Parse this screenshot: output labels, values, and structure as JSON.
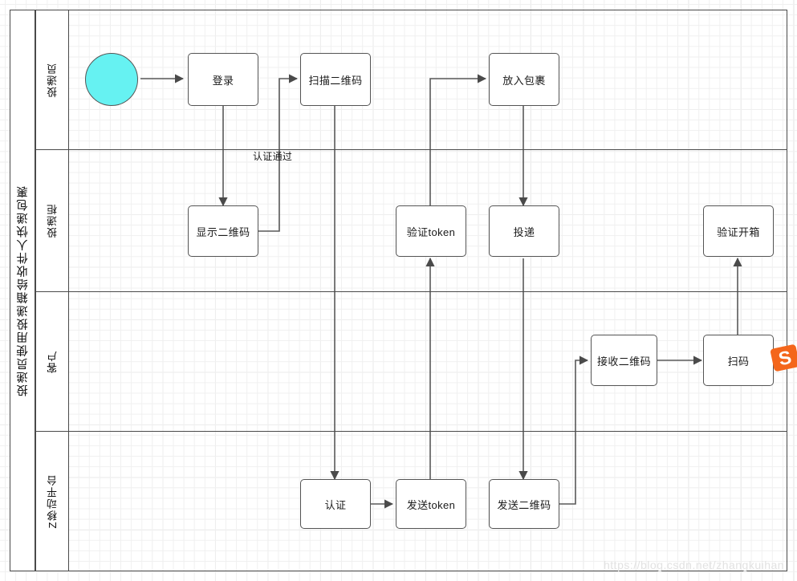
{
  "pool": {
    "title": "投递员使用投递箱给收件人快递包裹"
  },
  "lanes": [
    {
      "id": "courier",
      "label": "投递员"
    },
    {
      "id": "locker",
      "label": "投递柜"
    },
    {
      "id": "customer",
      "label": "客户"
    },
    {
      "id": "platform",
      "label": "Z移动平台"
    }
  ],
  "nodes": [
    {
      "id": "start",
      "label": "",
      "lane": "courier",
      "shape": "circle"
    },
    {
      "id": "login",
      "label": "登录",
      "lane": "courier",
      "shape": "rect"
    },
    {
      "id": "scan_qr",
      "label": "扫描二维码",
      "lane": "courier",
      "shape": "rect"
    },
    {
      "id": "put_package",
      "label": "放入包裹",
      "lane": "courier",
      "shape": "rect"
    },
    {
      "id": "show_qr",
      "label": "显示二维码",
      "lane": "locker",
      "shape": "rect"
    },
    {
      "id": "verify_token",
      "label": "验证token",
      "lane": "locker",
      "shape": "rect"
    },
    {
      "id": "deliver",
      "label": "投递",
      "lane": "locker",
      "shape": "rect"
    },
    {
      "id": "verify_open",
      "label": "验证开箱",
      "lane": "locker",
      "shape": "rect"
    },
    {
      "id": "receive_qr",
      "label": "接收二维码",
      "lane": "customer",
      "shape": "rect"
    },
    {
      "id": "scan_code",
      "label": "扫码",
      "lane": "customer",
      "shape": "rect"
    },
    {
      "id": "auth",
      "label": "认证",
      "lane": "platform",
      "shape": "rect"
    },
    {
      "id": "send_token",
      "label": "发送token",
      "lane": "platform",
      "shape": "rect"
    },
    {
      "id": "send_qr",
      "label": "发送二维码",
      "lane": "platform",
      "shape": "rect"
    }
  ],
  "edges": [
    {
      "from": "start",
      "to": "login",
      "label": ""
    },
    {
      "from": "login",
      "to": "show_qr",
      "label": ""
    },
    {
      "from": "show_qr",
      "to": "scan_qr",
      "label": "认证通过"
    },
    {
      "from": "scan_qr",
      "to": "auth",
      "label": ""
    },
    {
      "from": "auth",
      "to": "send_token",
      "label": ""
    },
    {
      "from": "send_token",
      "to": "verify_token",
      "label": ""
    },
    {
      "from": "verify_token",
      "to": "put_package",
      "label": ""
    },
    {
      "from": "put_package",
      "to": "deliver",
      "label": ""
    },
    {
      "from": "deliver",
      "to": "send_qr",
      "label": ""
    },
    {
      "from": "send_qr",
      "to": "receive_qr",
      "label": ""
    },
    {
      "from": "receive_qr",
      "to": "scan_code",
      "label": ""
    },
    {
      "from": "scan_code",
      "to": "verify_open",
      "label": ""
    }
  ],
  "edge_labels": {
    "auth_passed": "认证通过"
  },
  "watermark": {
    "text": "https://blog.csdn.net/zhangkuihan"
  },
  "colors": {
    "start_fill": "#66f2f2",
    "node_stroke": "#545454",
    "lane_stroke": "#4a4a4a",
    "edge_stroke": "#595959",
    "grid_minor": "#f0f0f0",
    "grid_major": "#e6e6e6",
    "sogou_orange": "#f4661b"
  },
  "logo": {
    "name": "sogou-input-logo",
    "letter": "S"
  }
}
